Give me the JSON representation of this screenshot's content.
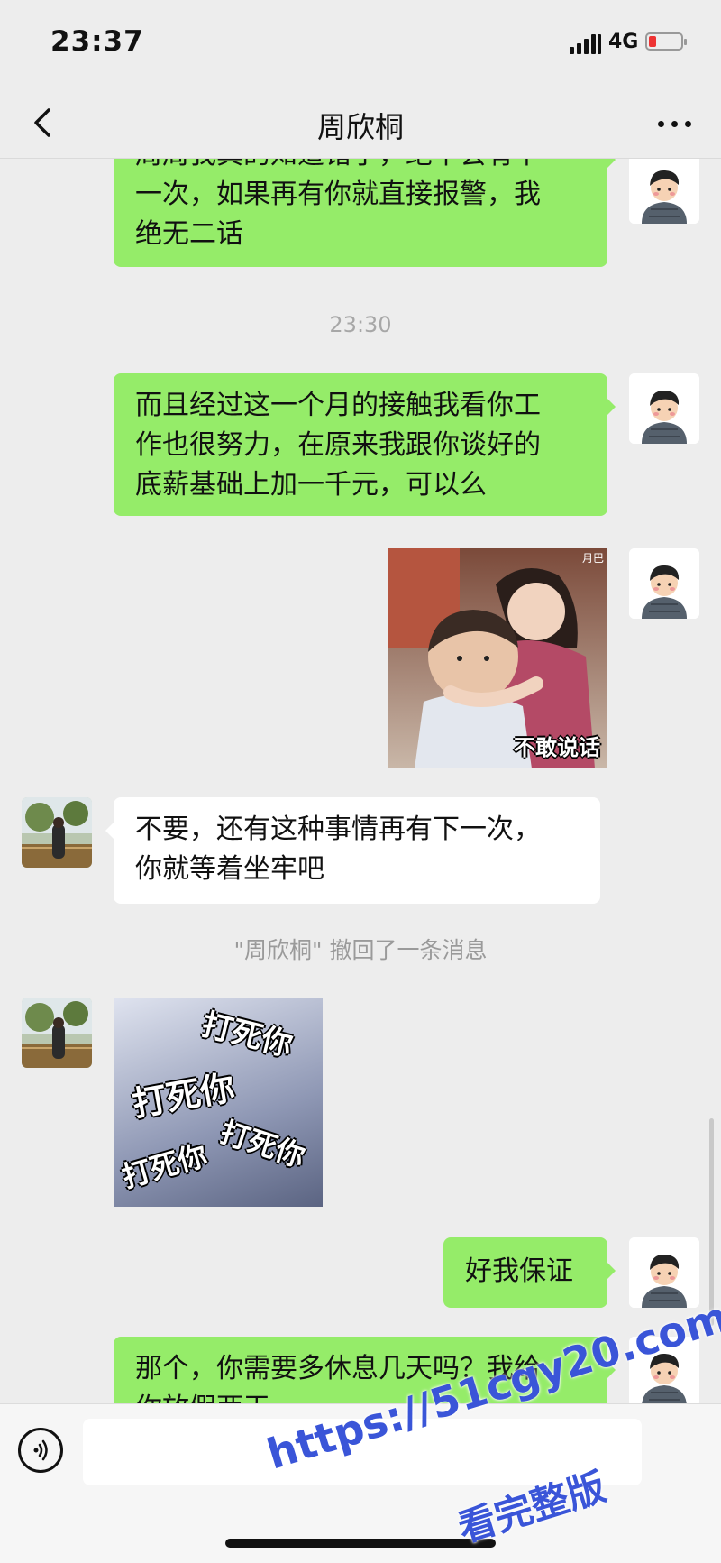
{
  "status": {
    "time": "23:37",
    "network": "4G"
  },
  "header": {
    "title": "周欣桐"
  },
  "messages": {
    "m1_line1": "周周我真的知道错了，绝不会有下",
    "m1_line2": "一次，如果再有你就直接报警，我",
    "m1_line3": "绝无二话",
    "time_divider": "23:30",
    "m2_line1": "而且经过这一个月的接触我看你工",
    "m2_line2": "作也很努力，在原来我跟你谈好的",
    "m2_line3": "底薪基础上加一千元，可以么",
    "sticker1_caption": "不敢说话",
    "sticker1_tag": "月巴",
    "m3_line1": "不要，还有这种事情再有下一次，",
    "m3_line2": "你就等着坐牢吧",
    "recall_notice": "\"周欣桐\" 撤回了一条消息",
    "sticker2_texts": [
      "打死你",
      "打死你",
      "打死你",
      "打死你"
    ],
    "m4": "好我保证",
    "m5_line1": "那个，你需要多休息几天吗？我给",
    "m5_line2": "你放假两天"
  },
  "watermark": {
    "line1": "https://51cgy20.com",
    "line2": "看完整版"
  },
  "colors": {
    "bg": "#ededed",
    "sent_bubble": "#95ec69",
    "recv_bubble": "#ffffff",
    "watermark": "#3a55d8"
  }
}
